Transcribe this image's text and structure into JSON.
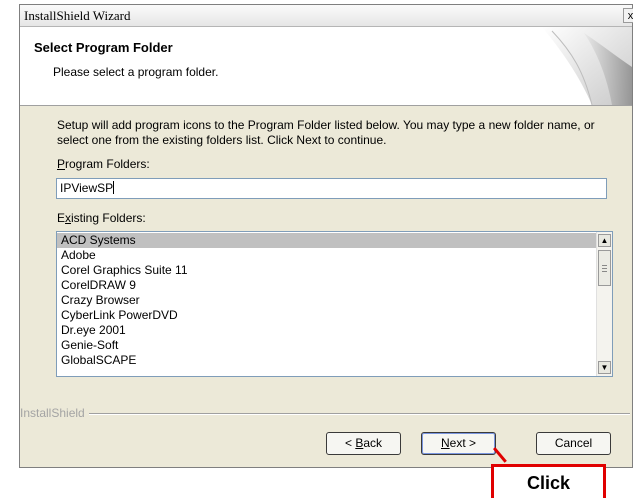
{
  "window": {
    "title": "InstallShield Wizard",
    "close_glyph": "x"
  },
  "header": {
    "title": "Select Program Folder",
    "subtitle": "Please select a program folder."
  },
  "description": "Setup will add program icons to the Program Folder listed below.  You may type a new folder name, or select one from the existing folders list.  Click Next to continue.",
  "program_folders": {
    "label_mnemonic": "P",
    "label_rest": "rogram Folders:",
    "value": "IPViewSP"
  },
  "existing_folders": {
    "label_pre": "E",
    "label_mnemonic": "x",
    "label_rest": "isting Folders:",
    "items": [
      "ACD Systems",
      "Adobe",
      "Corel Graphics Suite 11",
      "CorelDRAW 9",
      "Crazy Browser",
      "CyberLink PowerDVD",
      "Dr.eye 2001",
      "Genie-Soft",
      "GlobalSCAPE"
    ],
    "selected": "ACD Systems"
  },
  "brand": "InstallShield",
  "buttons": {
    "back_pre": "< ",
    "back_mnemonic": "B",
    "back_rest": "ack",
    "next_mnemonic": "N",
    "next_rest": "ext >",
    "cancel": "Cancel"
  },
  "callout": {
    "label": "Click",
    "color": "#e00000"
  }
}
